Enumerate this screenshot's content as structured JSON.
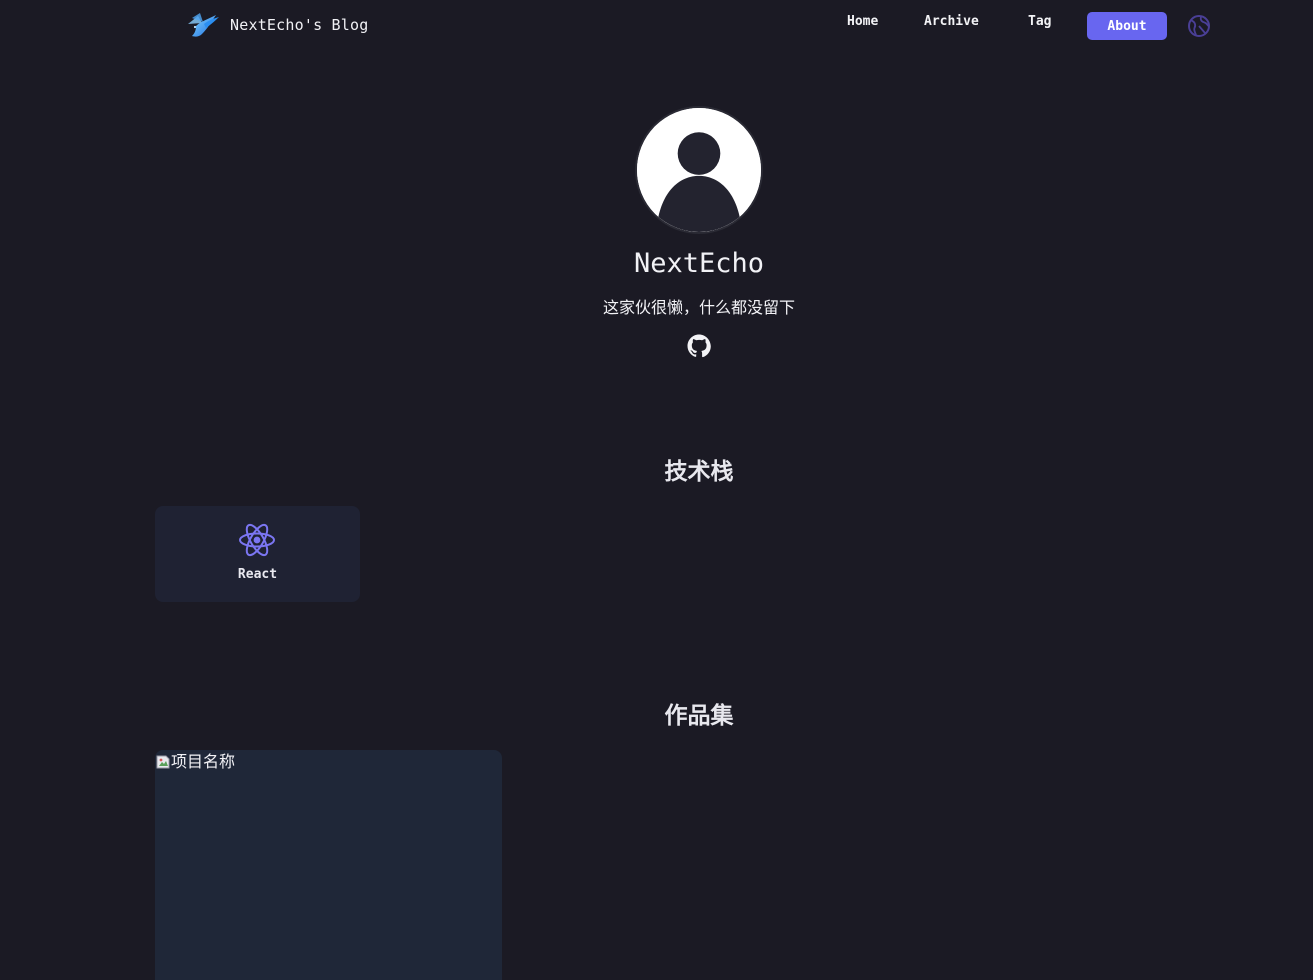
{
  "header": {
    "site_title": "NextEcho's Blog",
    "logo_icon": "bird-logo-icon",
    "nav": [
      {
        "label": "Home"
      },
      {
        "label": "Archive"
      },
      {
        "label": "Tag"
      },
      {
        "label": "About",
        "active": true
      }
    ],
    "language_icon": "globe-icon"
  },
  "profile": {
    "name": "NextEcho",
    "bio": "这家伙很懒，什么都没留下",
    "avatar_icon": "default-user-avatar",
    "social": [
      {
        "icon": "github-icon"
      }
    ]
  },
  "tech_stack": {
    "title": "技术栈",
    "items": [
      {
        "name": "React",
        "icon": "react-icon"
      }
    ]
  },
  "portfolio": {
    "title": "作品集",
    "projects": [
      {
        "image_alt": "项目名称"
      }
    ]
  },
  "colors": {
    "background": "#1b1a24",
    "accent": "#6866f0",
    "card": "#1f2233"
  }
}
